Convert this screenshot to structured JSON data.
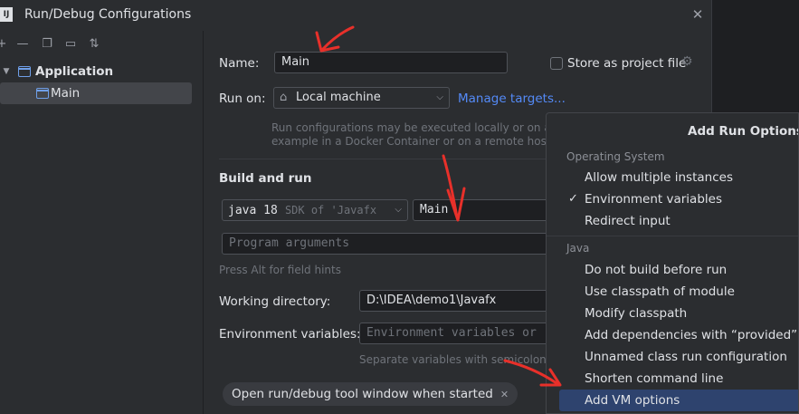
{
  "window": {
    "title": "Run/Debug Configurations",
    "logo_text": "IJ"
  },
  "toolbar": {
    "icons": [
      "add-icon",
      "remove-icon",
      "copy-icon",
      "new-folder-icon",
      "sort-icon"
    ]
  },
  "tree": {
    "group_label": "Application",
    "item_label": "Main"
  },
  "form": {
    "name_label": "Name:",
    "name_value": "Main",
    "store_label": "Store as project file",
    "run_on_label": "Run on:",
    "run_on_value": "Local machine",
    "manage_targets": "Manage targets...",
    "run_on_hint_1": "Run configurations may be executed locally or on a targ",
    "run_on_hint_2": "example in a Docker Container or on a remote host usin",
    "build_run_title": "Build and run",
    "java_version": "java 18",
    "sdk_text": "SDK of 'Javafx",
    "main_class": "Main",
    "program_args_placeholder": "Program arguments",
    "field_hint": "Press Alt for field hints",
    "working_dir_label": "Working directory:",
    "working_dir_value": "D:\\IDEA\\demo1\\Javafx",
    "env_vars_label": "Environment variables:",
    "env_vars_placeholder": "Environment variables or",
    "env_vars_hint": "Separate variables with semicolon: VA",
    "chip_label": "Open run/debug tool window when started"
  },
  "popup": {
    "title": "Add Run Options",
    "group_os": "Operating System",
    "os_items": [
      {
        "label": "Allow multiple instances",
        "checked": false
      },
      {
        "label": "Environment variables",
        "checked": true
      },
      {
        "label": "Redirect input",
        "checked": false
      }
    ],
    "group_java": "Java",
    "java_items": [
      {
        "label": "Do not build before run"
      },
      {
        "label": "Use classpath of module"
      },
      {
        "label": "Modify classpath"
      },
      {
        "label": "Add dependencies with “provided” sc"
      },
      {
        "label": "Unnamed class run configuration"
      },
      {
        "label": "Shorten command line"
      },
      {
        "label": "Add VM options"
      }
    ],
    "check_glyph": "✓"
  },
  "colors": {
    "accent": "#548af7",
    "highlight": "#2e436e",
    "annotation": "#e8302a"
  }
}
